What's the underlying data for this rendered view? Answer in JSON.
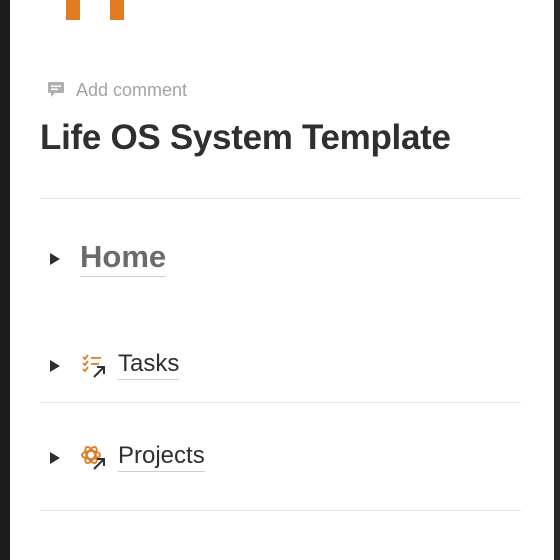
{
  "comment": {
    "label": "Add comment"
  },
  "page": {
    "title": "Life OS System Template"
  },
  "toggles": [
    {
      "label": "Home",
      "icon": "none"
    },
    {
      "label": "Tasks",
      "icon": "checklist-arrow-icon"
    },
    {
      "label": "Projects",
      "icon": "atom-arrow-icon"
    }
  ],
  "colors": {
    "accent": "#e07b1f",
    "text": "#2f2f2f",
    "muted": "#a3a3a3"
  }
}
